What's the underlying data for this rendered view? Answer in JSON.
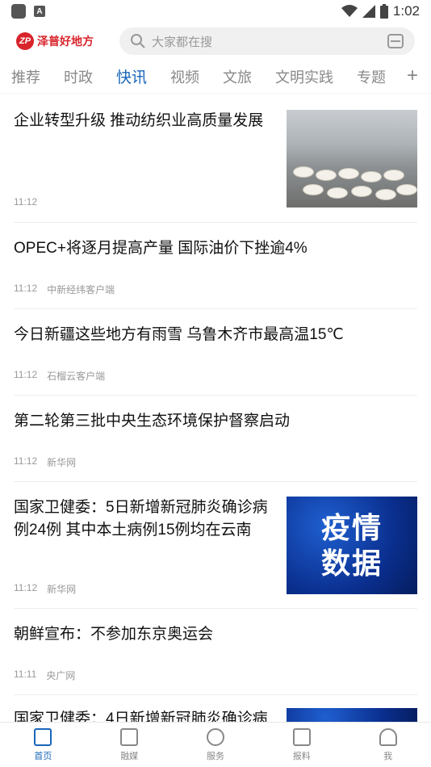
{
  "status_bar": {
    "time": "1:02"
  },
  "header": {
    "logo_text": "泽普好地方",
    "logo_mark": "ZP",
    "search_placeholder": "大家都在搜"
  },
  "tabs": [
    {
      "label": "推荐"
    },
    {
      "label": "时政"
    },
    {
      "label": "快讯"
    },
    {
      "label": "视频"
    },
    {
      "label": "文旅"
    },
    {
      "label": "文明实践"
    },
    {
      "label": "专题"
    }
  ],
  "tabs_add": "+",
  "news": [
    {
      "title": "企业转型升级 推动纺织业高质量发展",
      "time": "11:12",
      "source": ""
    },
    {
      "title": "OPEC+将逐月提高产量 国际油价下挫逾4%",
      "time": "11:12",
      "source": "中新经纬客户端"
    },
    {
      "title": "今日新疆这些地方有雨雪 乌鲁木齐市最高温15℃",
      "time": "11:12",
      "source": "石榴云客户端"
    },
    {
      "title": "第二轮第三批中央生态环境保护督察启动",
      "time": "11:12",
      "source": "新华网"
    },
    {
      "title": "国家卫健委：5日新增新冠肺炎确诊病例24例 其中本土病例15例均在云南",
      "time": "11:12",
      "source": "新华网"
    },
    {
      "title": "朝鲜宣布：不参加东京奥运会",
      "time": "11:11",
      "source": "央广网"
    },
    {
      "title": "国家卫健委：4日新增新冠肺炎确诊病"
    }
  ],
  "thumb_epidemic": {
    "line1": "疫情",
    "line2": "数据"
  },
  "bottom_nav": [
    {
      "label": "首页"
    },
    {
      "label": "融媒"
    },
    {
      "label": "服务"
    },
    {
      "label": "报料"
    },
    {
      "label": "我"
    }
  ],
  "colors": {
    "brand_red": "#d8252c",
    "active_blue": "#1a66b8"
  }
}
